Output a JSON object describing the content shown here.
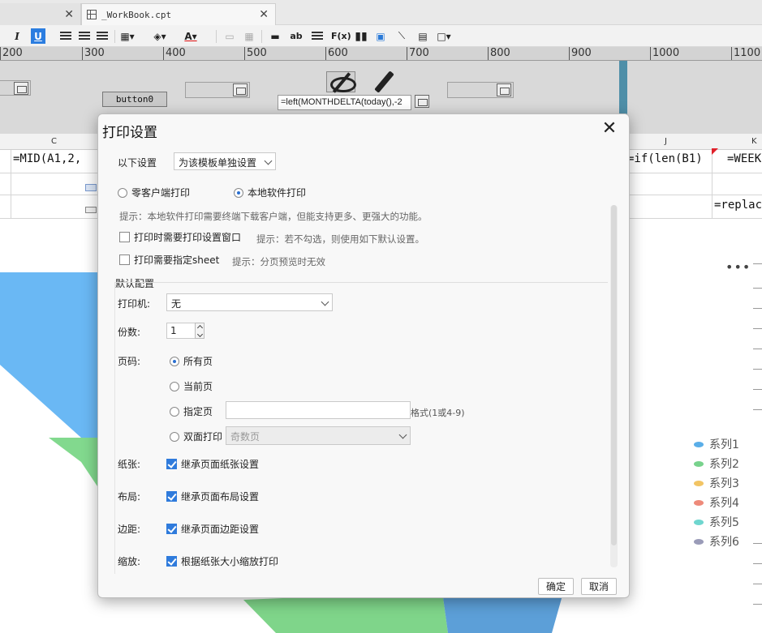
{
  "tabs": [
    {
      "label": ""
    },
    {
      "label": "_WorkBook.cpt"
    }
  ],
  "toolbar": {
    "italic": "I",
    "underline": "U",
    "text_ab": "ab",
    "formula": "F(x)"
  },
  "ruler": {
    "ticks": [
      "200",
      "300",
      "400",
      "500",
      "600",
      "700",
      "800",
      "900",
      "1000",
      "1100"
    ]
  },
  "design": {
    "button0": "button0",
    "formula_widget": "=left(MONTHDELTA(today(),-2"
  },
  "sheet": {
    "columns": [
      "C",
      "J",
      "K"
    ],
    "cells": {
      "c_formula": "=MID(A1,2,",
      "j_formula": "=if(len(B1)",
      "k_formula": "=WEEK",
      "k2_formula": "=replac"
    }
  },
  "chart_data": {
    "type": "pie",
    "title": "",
    "series": [
      {
        "name": "系列1"
      },
      {
        "name": "系列2"
      },
      {
        "name": "系列3"
      },
      {
        "name": "系列4"
      },
      {
        "name": "系列5"
      },
      {
        "name": "系列6"
      }
    ],
    "colors": [
      "#5aaee8",
      "#78d28c",
      "#f2c464",
      "#ee8a7a",
      "#6fd6cf",
      "#9a9bb8"
    ],
    "legend_position": "right",
    "more": "•••"
  },
  "dialog": {
    "title": "打印设置",
    "settings_label": "以下设置",
    "settings_value": "为该模板单独设置",
    "mode_zero_client": "零客户端打印",
    "mode_local": "本地软件打印",
    "hint_local": "提示：本地软件打印需要终端下载客户端，但能支持更多、更强大的功能。",
    "need_dialog": "打印时需要打印设置窗口",
    "need_dialog_hint": "提示：若不勾选，则使用如下默认设置。",
    "need_sheet": "打印需要指定sheet",
    "need_sheet_hint": "提示：分页预览时无效",
    "default_section": "默认配置",
    "printer_label": "打印机:",
    "printer_value": "无",
    "copies_label": "份数:",
    "copies_value": "1",
    "pages_label": "页码:",
    "page_all": "所有页",
    "page_current": "当前页",
    "page_specified": "指定页",
    "page_format": "格式(1或4-9)",
    "page_duplex": "双面打印",
    "duplex_value": "奇数页",
    "paper_label": "纸张:",
    "paper_check": "继承页面纸张设置",
    "layout_label": "布局:",
    "layout_check": "继承页面布局设置",
    "margin_label": "边距:",
    "margin_check": "继承页面边距设置",
    "scale_label": "缩放:",
    "scale_check": "根据纸张大小缩放打印",
    "ok": "确定",
    "cancel": "取消"
  }
}
